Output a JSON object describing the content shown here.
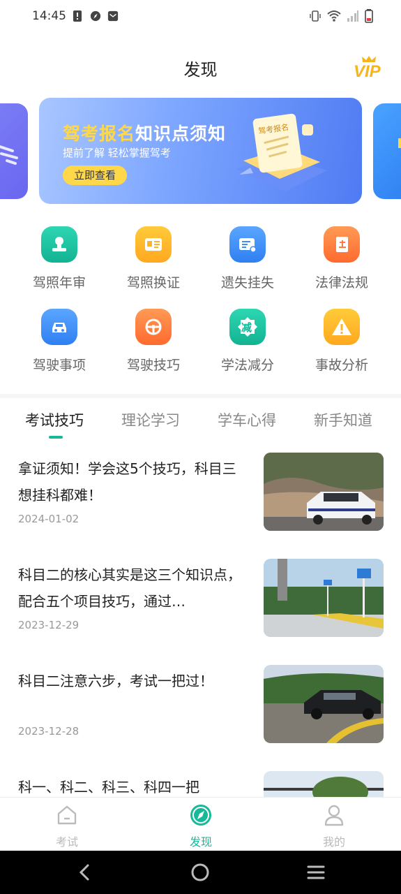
{
  "status_bar": {
    "time": "14:45"
  },
  "header": {
    "title": "发现",
    "vip_label": "VIP"
  },
  "banner": {
    "title_highlight": "驾考报名",
    "title_rest": "知识点须知",
    "subtitle": "提前了解 轻松掌握驾考",
    "button_label": "立即查看",
    "art_text": "驾考报名"
  },
  "services": [
    {
      "label": "驾照年审",
      "icon": "stamp-icon",
      "color": "#18c2a0"
    },
    {
      "label": "驾照换证",
      "icon": "license-card-icon",
      "color": "#ffb326"
    },
    {
      "label": "遗失挂失",
      "icon": "id-card-lost-icon",
      "color": "#3d8ef7"
    },
    {
      "label": "法律法规",
      "icon": "law-book-icon",
      "color": "#ff7a3d"
    },
    {
      "label": "驾驶事项",
      "icon": "car-icon",
      "color": "#3d8ef7"
    },
    {
      "label": "驾驶技巧",
      "icon": "steering-wheel-icon",
      "color": "#ff7a3d"
    },
    {
      "label": "学法减分",
      "icon": "reduce-points-icon",
      "color": "#18c2a0",
      "badge_text": "减"
    },
    {
      "label": "事故分析",
      "icon": "warning-icon",
      "color": "#ffb326"
    }
  ],
  "tabs": [
    {
      "label": "考试技巧",
      "active": true
    },
    {
      "label": "理论学习",
      "active": false
    },
    {
      "label": "学车心得",
      "active": false
    },
    {
      "label": "新手知道",
      "active": false
    }
  ],
  "articles": [
    {
      "title": "拿证须知！学会这5个技巧，科目三想挂科都难！",
      "date": "2024-01-02",
      "thumb": "police-car-photo"
    },
    {
      "title": "科目二的核心其实是这三个知识点，配合五个项目技巧，通过…",
      "date": "2023-12-29",
      "thumb": "test-course-photo"
    },
    {
      "title": "科目二注意六步，考试一把过！",
      "date": "2023-12-28",
      "thumb": "black-car-photo"
    },
    {
      "title": "科一、科二、科三、科四一把",
      "date": "",
      "thumb": "trees-photo"
    }
  ],
  "bottom_nav": [
    {
      "label": "考试",
      "icon": "home-icon",
      "active": false
    },
    {
      "label": "发现",
      "icon": "compass-icon",
      "active": true
    },
    {
      "label": "我的",
      "icon": "user-icon",
      "active": false
    }
  ],
  "colors": {
    "accent": "#18b89a",
    "banner_highlight": "#ffd84a"
  }
}
